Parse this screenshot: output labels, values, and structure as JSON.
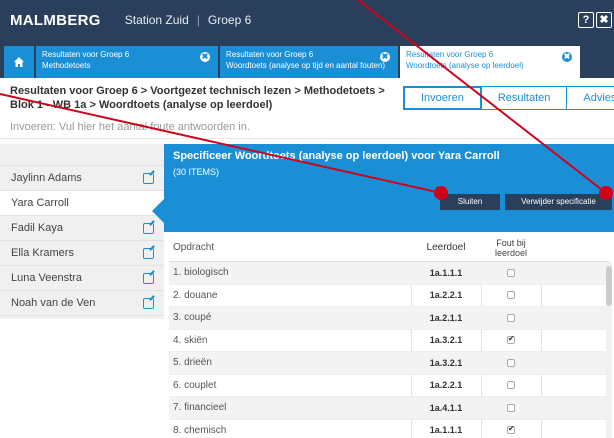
{
  "app": {
    "logo": "MALMBERG",
    "school": "Station Zuid",
    "separator": "|",
    "group": "Groep 6",
    "help_label": "?",
    "close_label": "✖"
  },
  "tabs": [
    {
      "line1": "Resultaten voor Groep 6",
      "line2": "Methodetoets",
      "close": "✖"
    },
    {
      "line1": "Resultaten voor Groep 6",
      "line2": "Woordtoets (analyse op tijd en aantal fouten)",
      "close": "✖"
    },
    {
      "line1": "Resultaten voor Groep 6",
      "line2": "Woordtoets (analyse op leerdoel)",
      "close": "✖"
    }
  ],
  "home_tab_icon": "home-icon",
  "breadcrumb": "Resultaten voor Groep 6 > Voortgezet technisch lezen > Methodetoets > Blok 1 - WB 1a > Woordtoets (analyse op leerdoel)",
  "segments": {
    "invoeren": "Invoeren",
    "resultaten": "Resultaten",
    "advies": "Advies"
  },
  "instruction": "Invoeren: Vul hier het aantal foute antwoorden in.",
  "students": [
    {
      "name": "Jaylinn Adams",
      "selected": false
    },
    {
      "name": "Yara Carroll",
      "selected": true
    },
    {
      "name": "Fadil Kaya",
      "selected": false
    },
    {
      "name": "Ella Kramers",
      "selected": false
    },
    {
      "name": "Luna Veenstra",
      "selected": false
    },
    {
      "name": "Noah van de Ven",
      "selected": false
    }
  ],
  "panel": {
    "title": "Specificeer Woordtoets (analyse op leerdoel) voor Yara Carroll",
    "items": "(30 ITEMS)",
    "sluiten": "Sluiten",
    "verwijder": "Verwijder specificatie"
  },
  "table": {
    "headers": {
      "opdracht": "Opdracht",
      "leerdoel": "Leerdoel",
      "fout_line1": "Fout bij",
      "fout_line2": "leerdoel"
    },
    "rows": [
      {
        "opdracht": "1. biologisch",
        "leerdoel": "1a.1.1.1",
        "checked": false
      },
      {
        "opdracht": "2. douane",
        "leerdoel": "1a.2.2.1",
        "checked": false
      },
      {
        "opdracht": "3. coupé",
        "leerdoel": "1a.2.1.1",
        "checked": false
      },
      {
        "opdracht": "4. skiën",
        "leerdoel": "1a.3.2.1",
        "checked": true
      },
      {
        "opdracht": "5. drieën",
        "leerdoel": "1a.3.2.1",
        "checked": false
      },
      {
        "opdracht": "6. couplet",
        "leerdoel": "1a.2.2.1",
        "checked": false
      },
      {
        "opdracht": "7. financieel",
        "leerdoel": "1a.4.1.1",
        "checked": false
      },
      {
        "opdracht": "8. chemisch",
        "leerdoel": "1a.1.1.1",
        "checked": true
      }
    ]
  },
  "colors": {
    "navy": "#2a3f5c",
    "blue": "#1b8fd6",
    "annotation_red": "#d0021b"
  }
}
